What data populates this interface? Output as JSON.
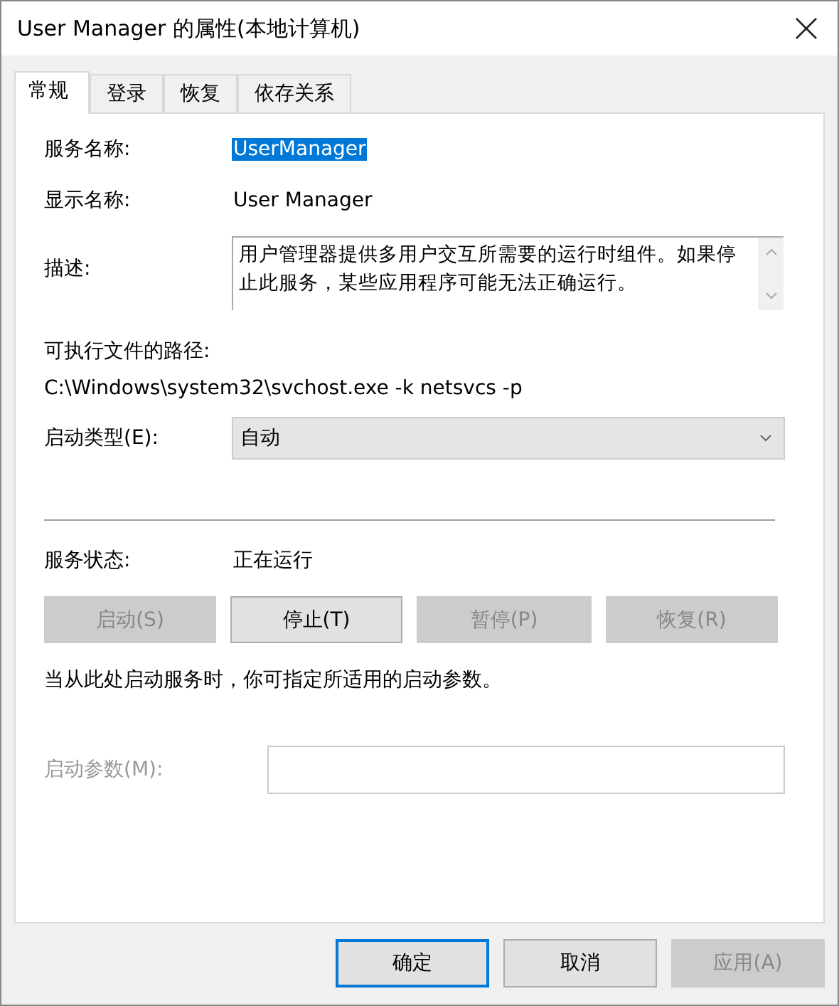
{
  "window": {
    "title": "User Manager 的属性(本地计算机)"
  },
  "tabs": [
    {
      "label": "常规",
      "selected": true
    },
    {
      "label": "登录",
      "selected": false
    },
    {
      "label": "恢复",
      "selected": false
    },
    {
      "label": "依存关系",
      "selected": false
    }
  ],
  "service_name": {
    "label": "服务名称:",
    "value": "UserManager",
    "highlighted": true
  },
  "display_name": {
    "label": "显示名称:",
    "value": "User Manager"
  },
  "description": {
    "label": "描述:",
    "text": "用户管理器提供多用户交互所需要的运行时组件。如果停止此服务，某些应用程序可能无法正确运行。"
  },
  "executable_path": {
    "label": "可执行文件的路径:",
    "value": "C:\\Windows\\system32\\svchost.exe -k netsvcs -p"
  },
  "startup_type": {
    "label": "启动类型(E):",
    "value": "自动"
  },
  "service_status": {
    "label": "服务状态:",
    "value": "正在运行"
  },
  "service_buttons": [
    {
      "label": "启动(S)",
      "disabled": true
    },
    {
      "label": "停止(T)",
      "disabled": false
    },
    {
      "label": "暂停(P)",
      "disabled": true
    },
    {
      "label": "恢复(R)",
      "disabled": true
    }
  ],
  "hint": "当从此处启动服务时，你可指定所适用的启动参数。",
  "start_parameters": {
    "label": "启动参数(M):",
    "disabled": true
  },
  "dialog_buttons": [
    {
      "label": "确定",
      "default": true,
      "disabled": false
    },
    {
      "label": "取消",
      "default": false,
      "disabled": false
    },
    {
      "label": "应用(A)",
      "default": false,
      "disabled": true
    }
  ]
}
